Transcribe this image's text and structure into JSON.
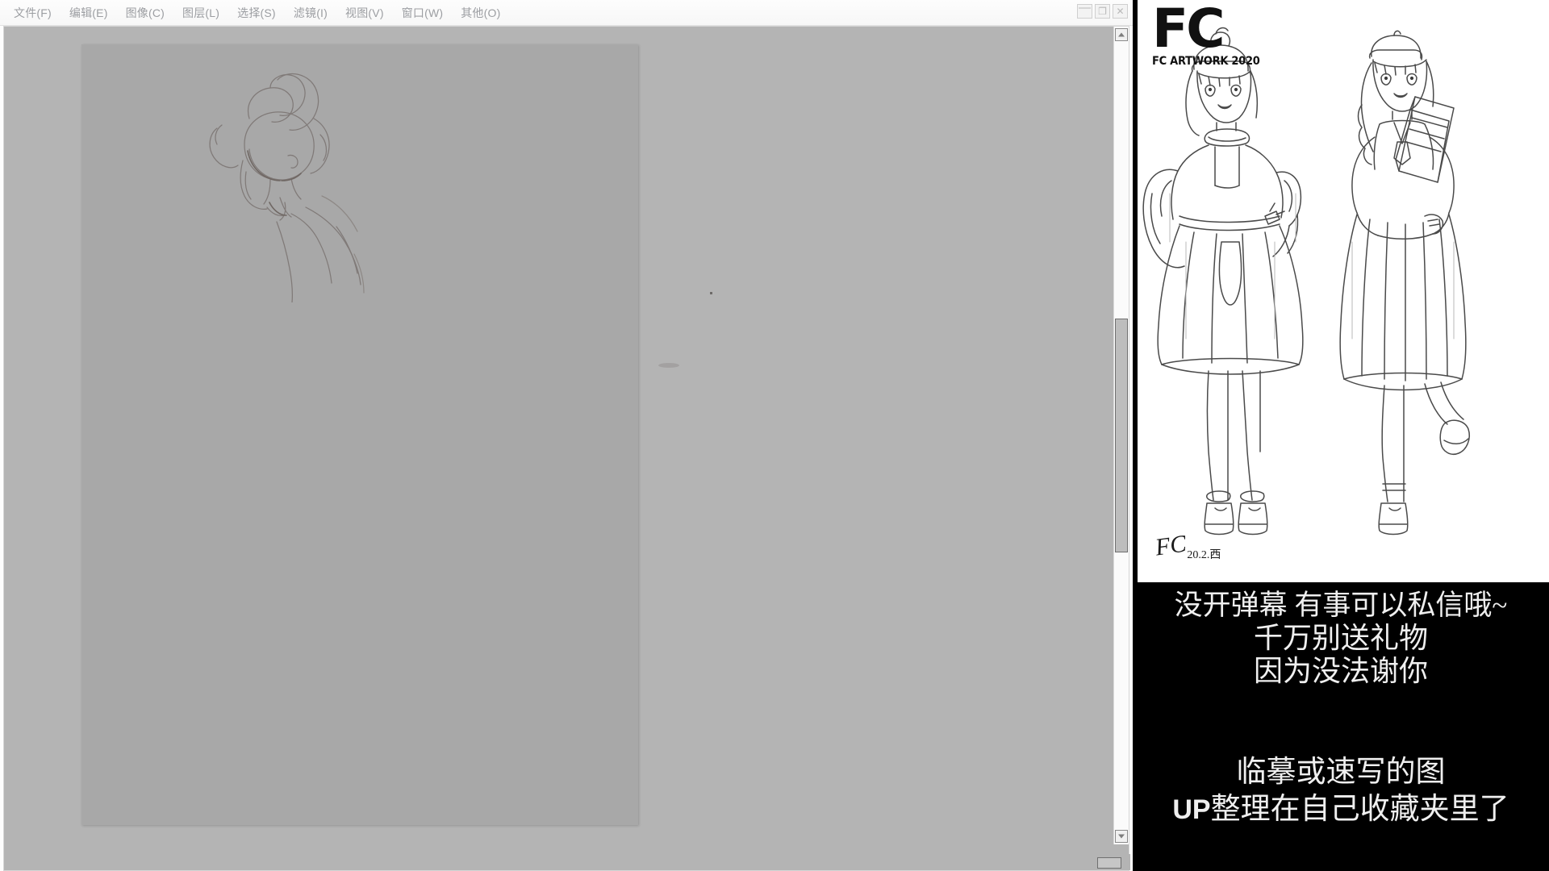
{
  "window": {
    "title": "",
    "controls": {
      "minimize": "—",
      "maximize": "❐",
      "close": "✕"
    }
  },
  "menubar": {
    "items": [
      {
        "label": "文件(F)"
      },
      {
        "label": "编辑(E)"
      },
      {
        "label": "图像(C)"
      },
      {
        "label": "图层(L)"
      },
      {
        "label": "选择(S)"
      },
      {
        "label": "滤镜(I)"
      },
      {
        "label": "视图(V)"
      },
      {
        "label": "窗口(W)"
      },
      {
        "label": "其他(O)"
      }
    ]
  },
  "canvas": {
    "background_color": "#b4b4b4",
    "document_color": "#a8a8a8",
    "content": "rough pencil sketch of a head and shoulders"
  },
  "artwork": {
    "logo_main": "FC",
    "logo_sub": "FC ARTWORK 2020",
    "signature_mark": "FC",
    "signature_date": "20.2.西",
    "description": "two anime girls line-art illustration, monochrome"
  },
  "subtitles": {
    "block_one": [
      "没开弹幕 有事可以私信哦~",
      "千万别送礼物",
      "因为没法谢你"
    ],
    "block_two_line_one": "临摹或速写的图",
    "block_two_prefix": "UP",
    "block_two_line_two": "整理在自己收藏夹里了"
  },
  "colors": {
    "panel_background": "#000000",
    "artwork_background": "#ffffff",
    "menu_text": "#9c9ea2",
    "workspace": "#b4b4b4"
  }
}
